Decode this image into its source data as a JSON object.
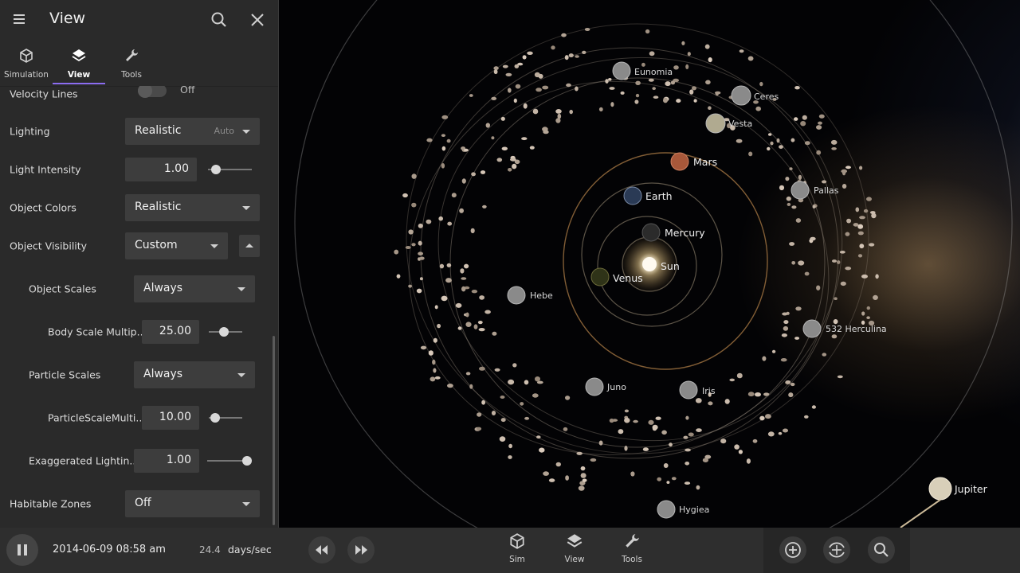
{
  "panel": {
    "title": "View",
    "tabs": [
      {
        "label": "Simulation",
        "icon": "cube-icon"
      },
      {
        "label": "View",
        "icon": "layers-icon"
      },
      {
        "label": "Tools",
        "icon": "wrench-icon"
      }
    ],
    "settings": {
      "velocity_lines": {
        "label": "Velocity Lines",
        "value": "Off"
      },
      "lighting": {
        "label": "Lighting",
        "value": "Realistic",
        "hint": "Auto"
      },
      "light_intensity": {
        "label": "Light Intensity",
        "value": "1.00",
        "slider": 0.18
      },
      "object_colors": {
        "label": "Object Colors",
        "value": "Realistic"
      },
      "object_visibility": {
        "label": "Object Visibility",
        "value": "Custom"
      },
      "object_scales": {
        "label": "Object Scales",
        "value": "Always"
      },
      "body_scale": {
        "label": "Body Scale Multip...",
        "value": "25.00",
        "slider": 0.45
      },
      "particle_scales": {
        "label": "Particle Scales",
        "value": "Always"
      },
      "particle_scale": {
        "label": "ParticleScaleMulti...",
        "value": "10.00",
        "slider": 0.2
      },
      "exaggerated_lighting": {
        "label": "Exaggerated Lightin...",
        "value": "1.00",
        "slider": 1.0
      },
      "habitable_zones": {
        "label": "Habitable Zones",
        "value": "Off"
      }
    }
  },
  "bottom": {
    "datetime": "2014-06-09 08:58 am",
    "rate_value": "24.4",
    "rate_unit": "days/sec",
    "tabs": [
      {
        "label": "Sim",
        "icon": "cube-icon"
      },
      {
        "label": "View",
        "icon": "layers-icon"
      },
      {
        "label": "Tools",
        "icon": "wrench-icon"
      }
    ]
  },
  "space": {
    "labels": {
      "sun": "Sun",
      "mercury": "Mercury",
      "venus": "Venus",
      "earth": "Earth",
      "mars": "Mars",
      "jupiter": "Jupiter",
      "ceres": "Ceres",
      "vesta": "Vesta",
      "pallas": "Pallas",
      "eunomia": "Eunomia",
      "hebe": "Hebe",
      "juno": "Juno",
      "iris": "Iris",
      "herculina": "532 Herculina",
      "hygiea": "Hygiea"
    }
  },
  "colors": {
    "accent": "#8b6cf0",
    "panel_bg": "#2a2a2a",
    "control_bg": "#3d3d3d",
    "bottom_bg": "#2e2e2e",
    "space_bg": "#030305"
  }
}
